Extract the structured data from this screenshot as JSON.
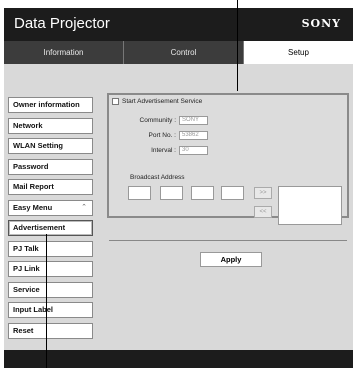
{
  "window": {
    "title": "Data Projector",
    "brand": "SONY"
  },
  "tabs": [
    {
      "label": "Information"
    },
    {
      "label": "Control"
    },
    {
      "label": "Setup"
    }
  ],
  "sidebar": {
    "items": [
      {
        "label": "Owner information"
      },
      {
        "label": "Network"
      },
      {
        "label": "WLAN Setting"
      },
      {
        "label": "Password"
      },
      {
        "label": "Mail Report"
      },
      {
        "label": "Easy Menu"
      },
      {
        "label": "Advertisement"
      },
      {
        "label": "PJ Talk"
      },
      {
        "label": "PJ Link"
      },
      {
        "label": "Service"
      },
      {
        "label": "Input Label"
      },
      {
        "label": "Reset"
      }
    ],
    "active": "Advertisement"
  },
  "advertisement": {
    "start_label": "Start Advertisement Service",
    "community_label": "Community :",
    "community_value": "SONY",
    "port_label": "Port No. :",
    "port_value": "53862",
    "interval_label": "Interval :",
    "interval_value": "30",
    "broadcast_label": "Broadcast Address",
    "add_label": ">>",
    "remove_label": "<<"
  },
  "apply_label": "Apply",
  "icons": {
    "chevron": "double-chevron-up-icon"
  }
}
